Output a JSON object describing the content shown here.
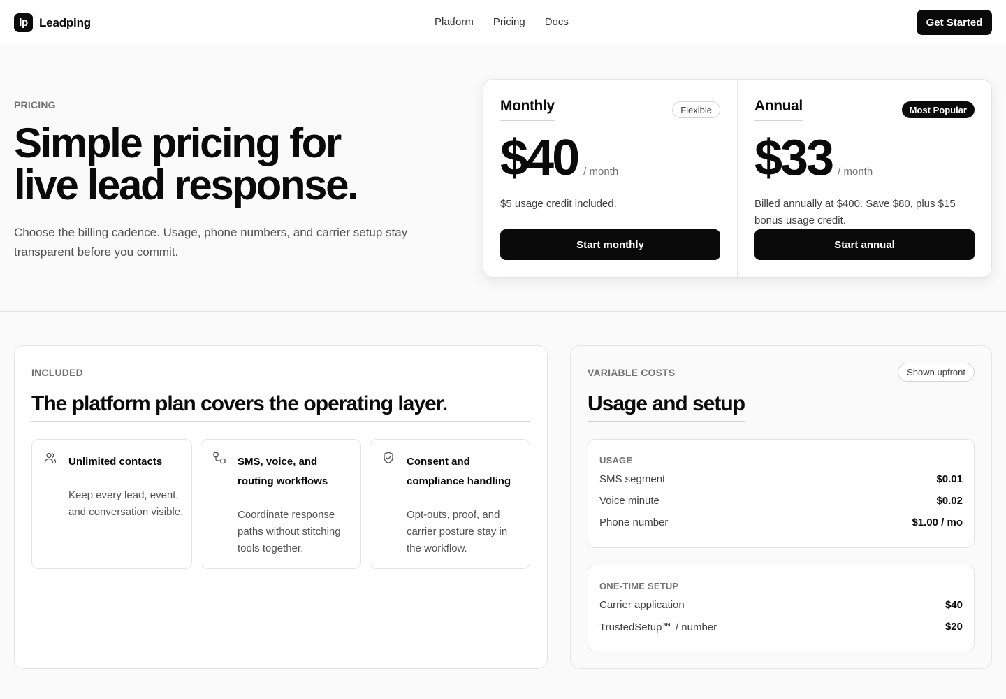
{
  "brand": {
    "mark": "lp",
    "name": "Leadping"
  },
  "nav": {
    "items": [
      "Platform",
      "Pricing",
      "Docs"
    ],
    "cta": "Get Started"
  },
  "hero": {
    "eyebrow": "PRICING",
    "title_line1": "Simple pricing for",
    "title_line2": "live lead response.",
    "subtitle": "Choose the billing cadence. Usage, phone numbers, and carrier setup stay transparent before you commit."
  },
  "plans": [
    {
      "name": "Monthly",
      "badge": "Flexible",
      "price": "$40",
      "unit": "/ month",
      "note": "$5 usage credit included.",
      "button": "Start monthly"
    },
    {
      "name": "Annual",
      "badge": "Most Popular",
      "price": "$33",
      "unit": "/ month",
      "note": "Billed annually at $400. Save $80, plus $15 bonus usage credit.",
      "button": "Start annual"
    }
  ],
  "included": {
    "eyebrow": "INCLUDED",
    "title": "The platform plan covers the operating layer.",
    "features": [
      {
        "icon": "users-icon",
        "title": "Unlimited contacts",
        "desc": "Keep every lead, event, and conversation visible."
      },
      {
        "icon": "workflow-icon",
        "title": "SMS, voice, and routing workflows",
        "desc": "Coordinate response paths without stitching tools together."
      },
      {
        "icon": "shield-check-icon",
        "title": "Consent and compliance handling",
        "desc": "Opt-outs, proof, and carrier posture stay in the workflow."
      }
    ]
  },
  "variable": {
    "eyebrow": "VARIABLE COSTS",
    "badge": "Shown upfront",
    "title": "Usage and setup",
    "usage": {
      "label": "USAGE",
      "rows": [
        {
          "name": "SMS segment",
          "value": "$0.01"
        },
        {
          "name": "Voice minute",
          "value": "$0.02"
        },
        {
          "name": "Phone number",
          "value": "$1.00 / mo"
        }
      ]
    },
    "setup": {
      "label": "ONE-TIME SETUP",
      "rows": [
        {
          "name": "Carrier application",
          "value": "$40"
        },
        {
          "name": "TrustedSetup℠ / number",
          "value": "$20"
        }
      ]
    }
  },
  "colors": {
    "ink": "#0a0a0a",
    "muted": "#737373",
    "border": "#e5e5e5",
    "surface": "#fafafa"
  }
}
